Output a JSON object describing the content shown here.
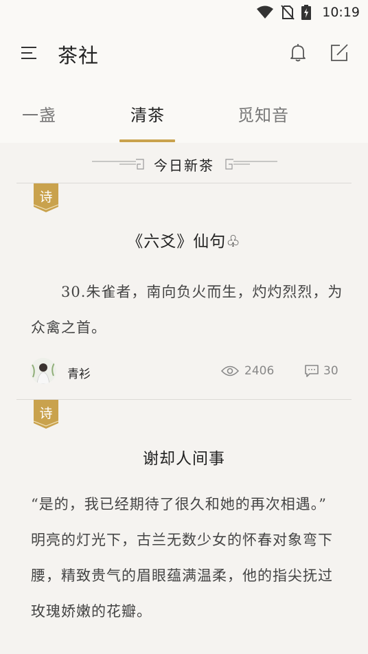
{
  "status_bar": {
    "time": "10:19",
    "icons": [
      "wifi-icon",
      "no-sim-icon",
      "battery-charging-icon"
    ]
  },
  "app_bar": {
    "title": "茶社",
    "icons": [
      "menu-icon",
      "bell-icon",
      "edit-icon"
    ]
  },
  "tabs": [
    {
      "label": "一盏",
      "active": false
    },
    {
      "label": "清茶",
      "active": true
    },
    {
      "label": "觅知音",
      "active": false
    }
  ],
  "colors": {
    "accent": "#c9a24d",
    "background": "#f5f3f0",
    "header_background": "#faf9f6"
  },
  "section": {
    "title": "今日新茶"
  },
  "posts": [
    {
      "badge": "诗",
      "title": "《六爻》仙句♧",
      "body": [
        "30.朱雀者，南向负火而生，灼灼烈烈，为众禽之首。"
      ],
      "author": "青衫",
      "views": "2406",
      "comments": "30"
    },
    {
      "badge": "诗",
      "title": "谢却人间事",
      "body": [
        " “是的，我已经期待了很久和她的再次相遇。”",
        " 明亮的灯光下，古兰无数少女的怀春对象弯下腰，精致贵气的眉眼蕴满温柔，他的指尖抚过玫瑰娇嫩的花瓣。"
      ]
    }
  ]
}
